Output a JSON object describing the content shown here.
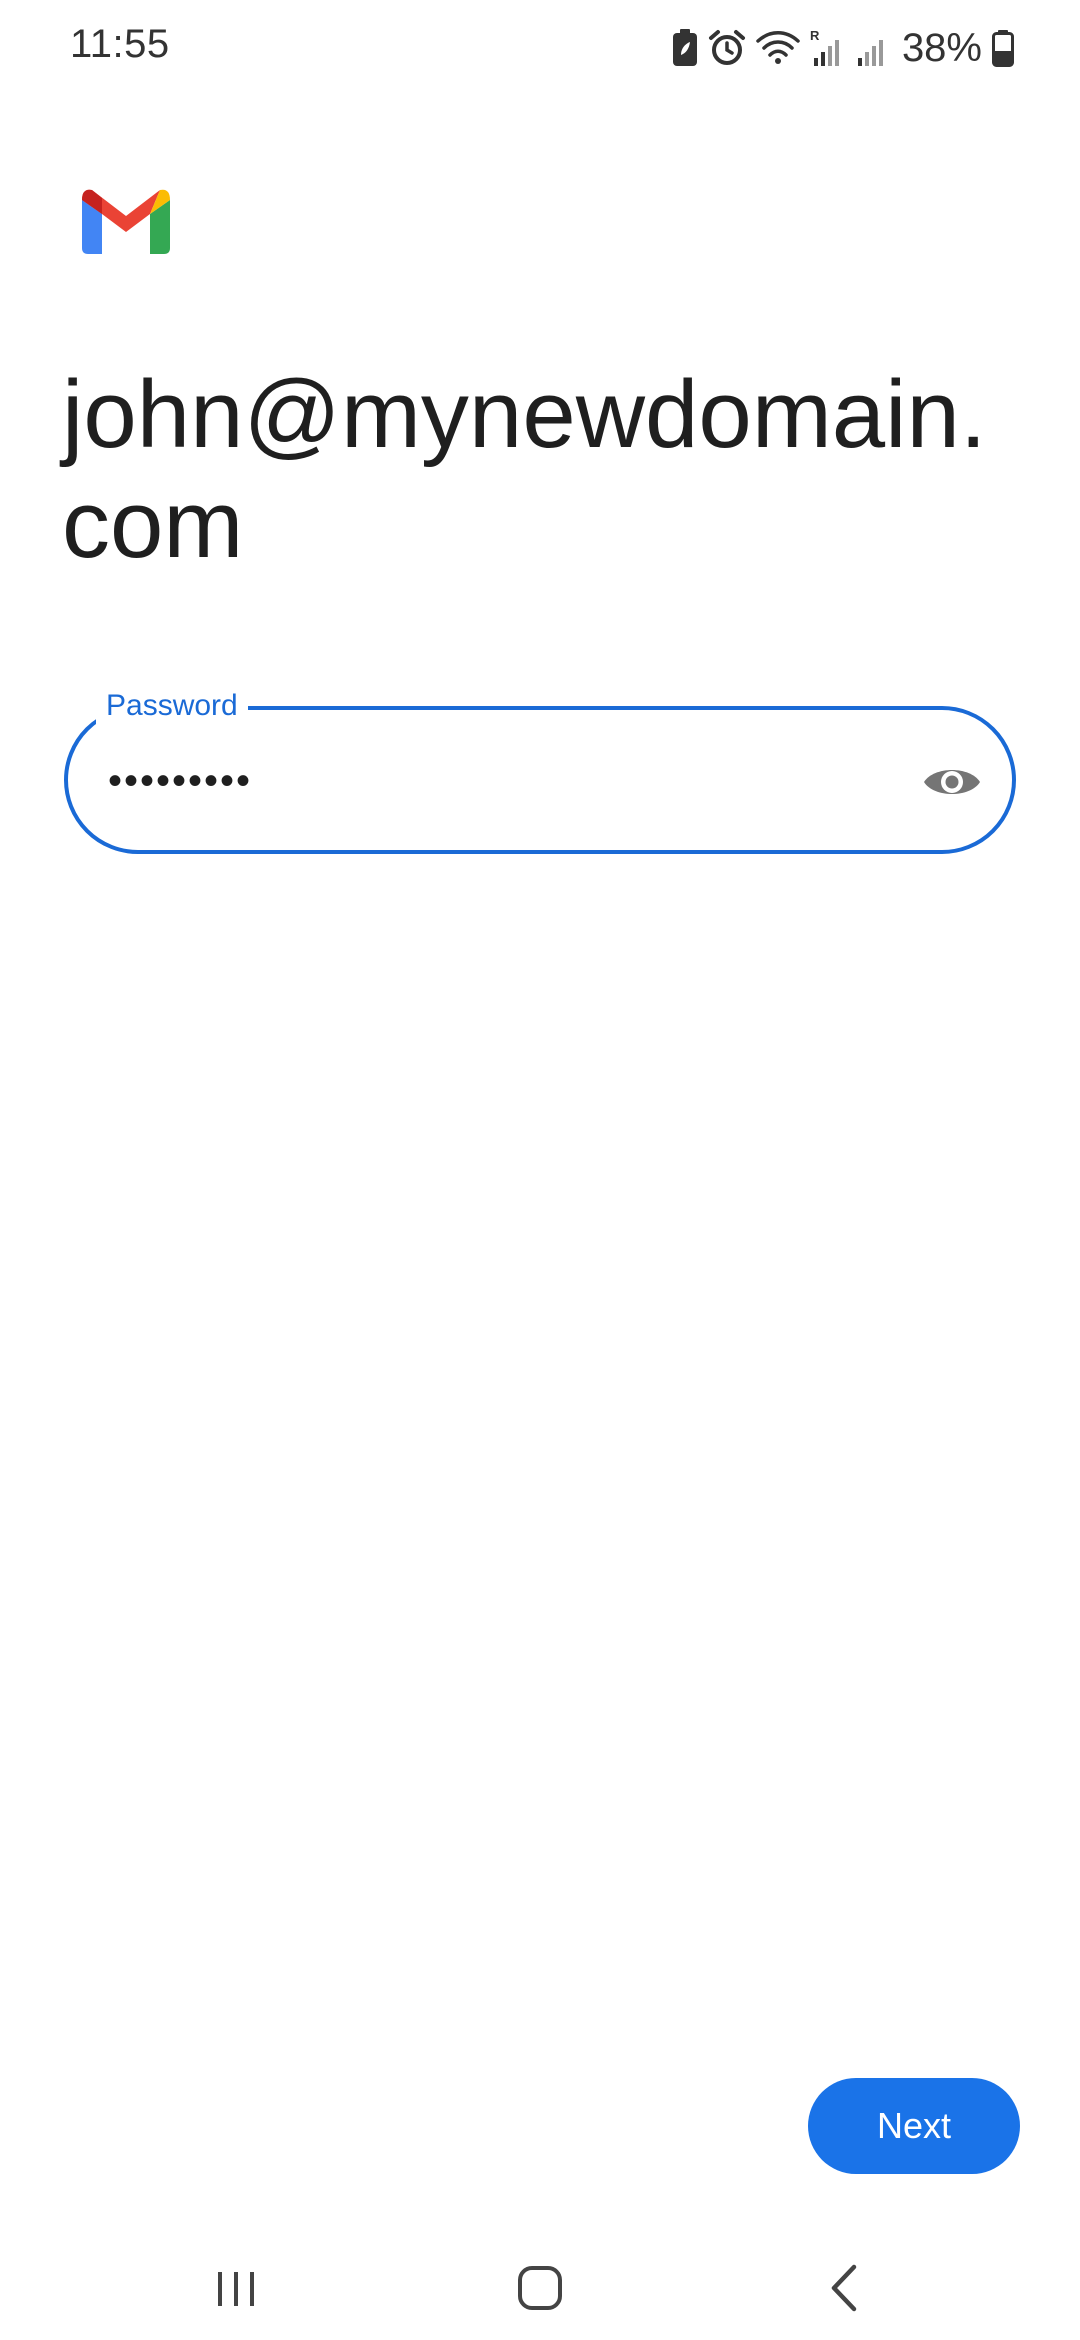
{
  "status_bar": {
    "time": "11:55",
    "battery_percent": "38%",
    "icons": [
      "battery-saver-icon",
      "alarm-icon",
      "wifi-icon",
      "signal-roaming-icon",
      "signal-icon",
      "battery-icon"
    ]
  },
  "logo": {
    "icon": "gmail-logo-icon",
    "colors": [
      "#ea4335",
      "#4285f4",
      "#34a853",
      "#fbbc04",
      "#c5221f"
    ]
  },
  "account": {
    "email": "john@mynewdomain.com"
  },
  "password_field": {
    "label": "Password",
    "value": "•••••••••",
    "toggle_icon": "eye-icon"
  },
  "actions": {
    "next_label": "Next"
  },
  "nav_bar": {
    "items": [
      "recents-icon",
      "home-icon",
      "back-icon"
    ]
  },
  "colors": {
    "accent": "#1a73e8",
    "field_border": "#1a6ad6",
    "text": "#1f1f1f"
  }
}
